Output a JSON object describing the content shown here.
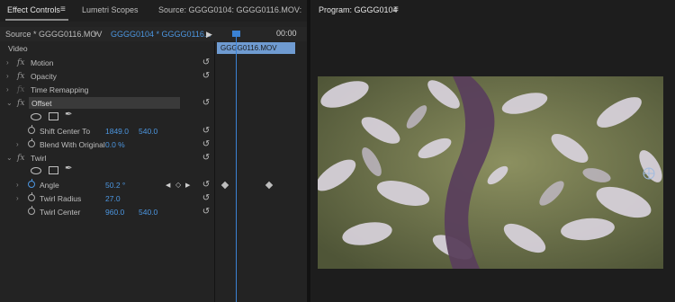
{
  "tabs": {
    "effect_controls": "Effect Controls",
    "lumetri": "Lumetri Scopes",
    "source": "Source: GGGG0104: GGGG0116.MOV:",
    "program": "Program: GGGG0104"
  },
  "source_row": {
    "source": "Source * GGGG0116.MOV",
    "sequence": "GGGG0104 * GGGG0116...",
    "timecode": "00:00"
  },
  "clip_name": "GGGG0116.MOV",
  "video_label": "Video",
  "effects": {
    "motion": "Motion",
    "opacity": "Opacity",
    "time_remapping": "Time Remapping",
    "offset": "Offset",
    "shift_center_label": "Shift Center To",
    "shift_center_x": "1849.0",
    "shift_center_y": "540.0",
    "blend_label": "Blend With Original",
    "blend_value": "0.0 %",
    "twirl": "Twirl",
    "angle_label": "Angle",
    "angle_value": "50.2 °",
    "radius_label": "Twirl Radius",
    "radius_value": "27.0",
    "center_label": "Twirl Center",
    "center_x": "960.0",
    "center_y": "540.0"
  },
  "colors": {
    "accent": "#4c96e0",
    "clip": "#6f9bd1"
  }
}
